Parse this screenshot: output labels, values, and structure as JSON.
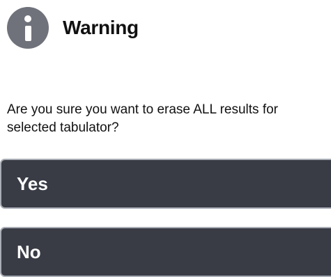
{
  "dialog": {
    "title": "Warning",
    "icon": "info-icon",
    "message": "Are you sure you want to erase ALL results for selected tabulator?",
    "buttons": {
      "yes_label": "Yes",
      "no_label": "No"
    }
  },
  "colors": {
    "icon_bg": "#6f727a",
    "button_bg": "#393c45",
    "button_border": "#a9adb6",
    "text": "#111111"
  }
}
